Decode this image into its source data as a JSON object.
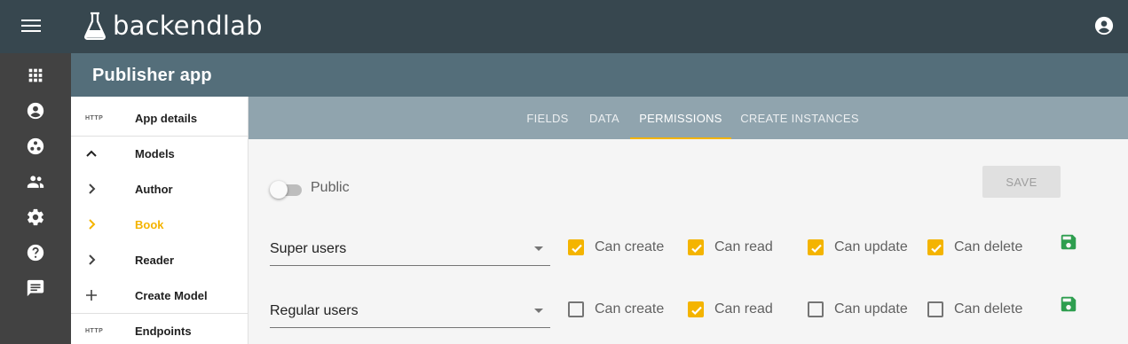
{
  "header": {
    "brand": "backendlab"
  },
  "rail": {
    "icons": [
      "apps-icon",
      "account-circle-icon",
      "group-work-icon",
      "people-icon",
      "settings-icon",
      "help-icon",
      "feedback-icon"
    ]
  },
  "app": {
    "title": "Publisher app"
  },
  "sidenav": {
    "app_details": {
      "badge": "HTTP",
      "label": "App details"
    },
    "models": {
      "label": "Models"
    },
    "model_items": [
      {
        "label": "Author"
      },
      {
        "label": "Book"
      },
      {
        "label": "Reader"
      }
    ],
    "create_model": {
      "label": "Create Model"
    },
    "endpoints": {
      "badge": "HTTP",
      "label": "Endpoints"
    }
  },
  "tabs": [
    {
      "label": "FIELDS"
    },
    {
      "label": "DATA"
    },
    {
      "label": "PERMISSIONS"
    },
    {
      "label": "CREATE INSTANCES"
    }
  ],
  "active_tab": "PERMISSIONS",
  "permissions": {
    "public_label": "Public",
    "public_on": false,
    "save_label": "SAVE",
    "rows": [
      {
        "role": "Super users",
        "perms": [
          {
            "label": "Can create",
            "checked": true
          },
          {
            "label": "Can read",
            "checked": true
          },
          {
            "label": "Can update",
            "checked": true
          },
          {
            "label": "Can delete",
            "checked": true
          }
        ]
      },
      {
        "role": "Regular users",
        "perms": [
          {
            "label": "Can create",
            "checked": false
          },
          {
            "label": "Can read",
            "checked": true
          },
          {
            "label": "Can update",
            "checked": false
          },
          {
            "label": "Can delete",
            "checked": false
          }
        ]
      }
    ]
  },
  "colors": {
    "topbar": "#37474f",
    "rail": "#424242",
    "appbar": "#546e7a",
    "tabbar": "#90a4ae",
    "accent": "#f4b400",
    "save_green": "#2e9e4f"
  }
}
